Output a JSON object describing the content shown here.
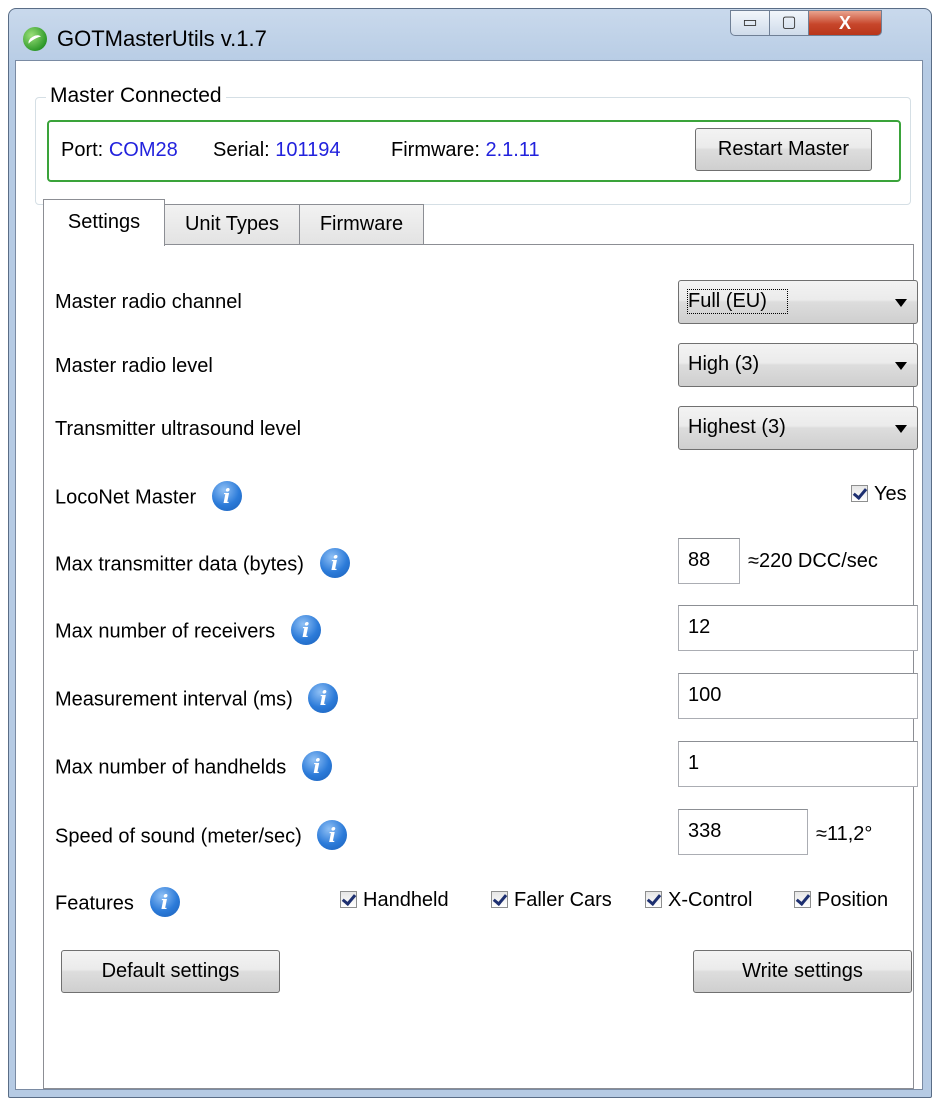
{
  "window": {
    "title": "GOTMasterUtils v.1.7",
    "min_glyph": "▭",
    "max_glyph": "▢",
    "close_glyph": "X"
  },
  "connection": {
    "group_label": "Master Connected",
    "port_label": "Port:",
    "port_value": "COM28",
    "serial_label": "Serial:",
    "serial_value": "101194",
    "firmware_label": "Firmware:",
    "firmware_value": "2.1.11",
    "restart_button": "Restart Master"
  },
  "tabs": [
    {
      "label": "Settings",
      "active": true
    },
    {
      "label": "Unit Types",
      "active": false
    },
    {
      "label": "Firmware",
      "active": false
    }
  ],
  "settings": {
    "radio_channel": {
      "label": "Master radio channel",
      "value": "Full (EU)"
    },
    "radio_level": {
      "label": "Master radio level",
      "value": "High (3)"
    },
    "ultrasound_level": {
      "label": "Transmitter ultrasound level",
      "value": "Highest (3)"
    },
    "loconet_master": {
      "label": "LocoNet Master",
      "checkbox_label": "Yes",
      "checked": true
    },
    "max_tx_data": {
      "label": "Max transmitter data (bytes)",
      "value": "88",
      "note": "≈220 DCC/sec"
    },
    "max_receivers": {
      "label": "Max number of receivers",
      "value": "12"
    },
    "measurement_interval": {
      "label": "Measurement interval (ms)",
      "value": "100"
    },
    "max_handhelds": {
      "label": "Max number of handhelds",
      "value": "1"
    },
    "speed_of_sound": {
      "label": "Speed of sound (meter/sec)",
      "value": "338",
      "note": "≈11,2°"
    },
    "features": {
      "label": "Features",
      "items": [
        {
          "label": "Handheld",
          "checked": true
        },
        {
          "label": "Faller Cars",
          "checked": true
        },
        {
          "label": "X-Control",
          "checked": true
        },
        {
          "label": "Position",
          "checked": true
        }
      ]
    },
    "default_button": "Default settings",
    "write_button": "Write settings"
  },
  "colors": {
    "link_blue": "#2222dd",
    "connected_green": "#3aa33a",
    "close_red": "#c7462b",
    "info_blue": "#2c7bd9"
  }
}
